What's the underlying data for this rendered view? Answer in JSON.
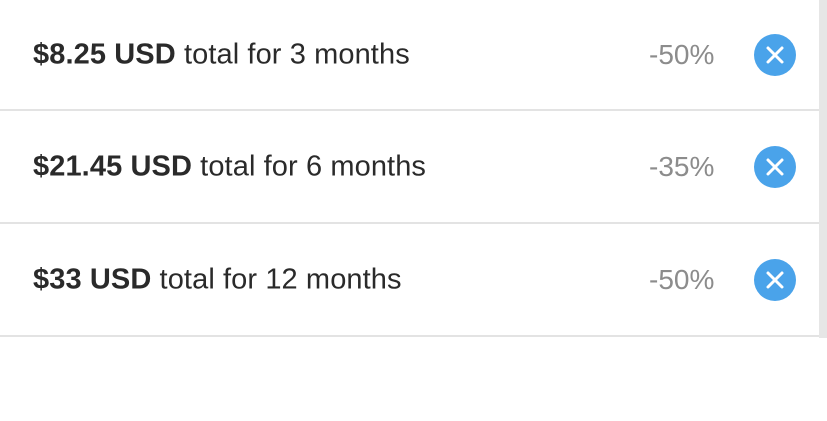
{
  "plans": [
    {
      "price": "$8.25 USD",
      "description": "total for 3 months",
      "discount": "-50%",
      "remove_icon": "close-circle-icon"
    },
    {
      "price": "$21.45 USD",
      "description": "total for 6 months",
      "discount": "-35%",
      "remove_icon": "close-circle-icon"
    },
    {
      "price": "$33 USD",
      "description": "total for 12 months",
      "discount": "-50%",
      "remove_icon": "close-circle-icon"
    }
  ],
  "colors": {
    "accent": "#4aa3ea",
    "discount_text": "#8c8c8c",
    "divider": "#e3e3e3"
  }
}
